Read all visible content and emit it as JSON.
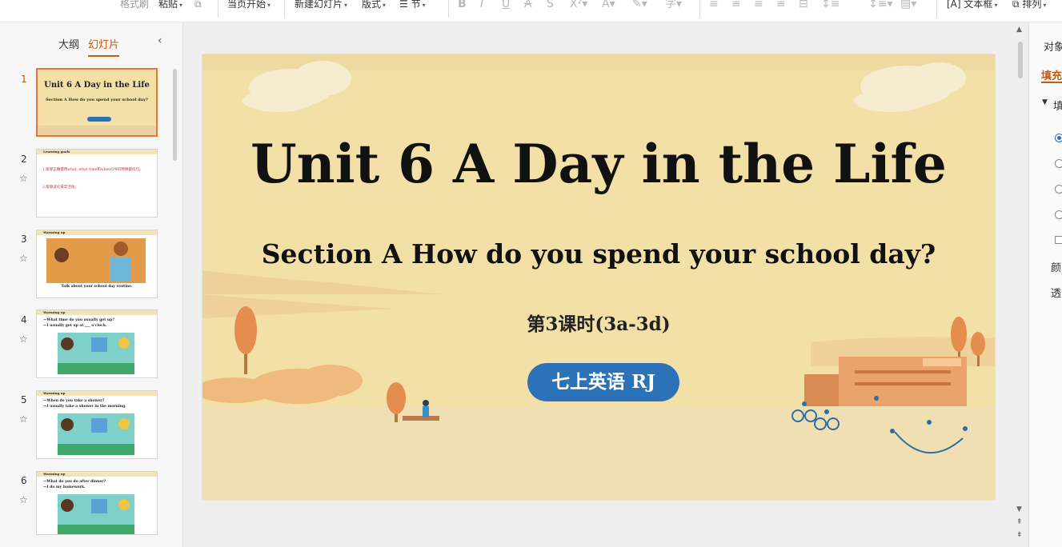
{
  "ribbon": {
    "format_painter": "格式刷",
    "paste": "粘贴",
    "current_page_start": "当页开始",
    "new_slide": "新建幻灯片",
    "layout": "版式",
    "section": "节",
    "textbox": "文本框",
    "arrange": "排列"
  },
  "left_panel": {
    "tab_outline": "大纲",
    "tab_slides": "幻灯片",
    "slides": [
      {
        "number": "1",
        "title": "Unit 6 A Day in the Life",
        "subtitle": "Section A How do you spend your school day?"
      },
      {
        "number": "2",
        "header": "Learning goals",
        "line1": "1.能够正确使用what, what time和when引导的特殊疑问句。",
        "line2": "2.能够谈论日常活动。"
      },
      {
        "number": "3",
        "header": "Warming up",
        "caption": "Talk about your school day routine."
      },
      {
        "number": "4",
        "header": "Warming up",
        "line1": "—What time do you usually get up?",
        "line2": "—I usually get up at ___ o'clock."
      },
      {
        "number": "5",
        "header": "Warming up",
        "line1": "—When do you take a shower?",
        "line2": "—I usually take a shower in the morning."
      },
      {
        "number": "6",
        "header": "Warming up",
        "line1": "—What do you do after dinner?",
        "line2": "—I do my homework."
      }
    ]
  },
  "slide": {
    "title": "Unit 6 A Day in the Life",
    "subtitle": "Section A How do you spend your school day?",
    "lesson": "第3课时(3a-3d)",
    "badge": "七上英语 RJ"
  },
  "right_panel": {
    "object": "对象",
    "fill": "填充",
    "fill_section": "填",
    "color": "颜",
    "transparency": "透"
  },
  "colors": {
    "accent": "#c55a11",
    "slide_bg": "#f3e0a6",
    "badge": "#2c72b8"
  }
}
